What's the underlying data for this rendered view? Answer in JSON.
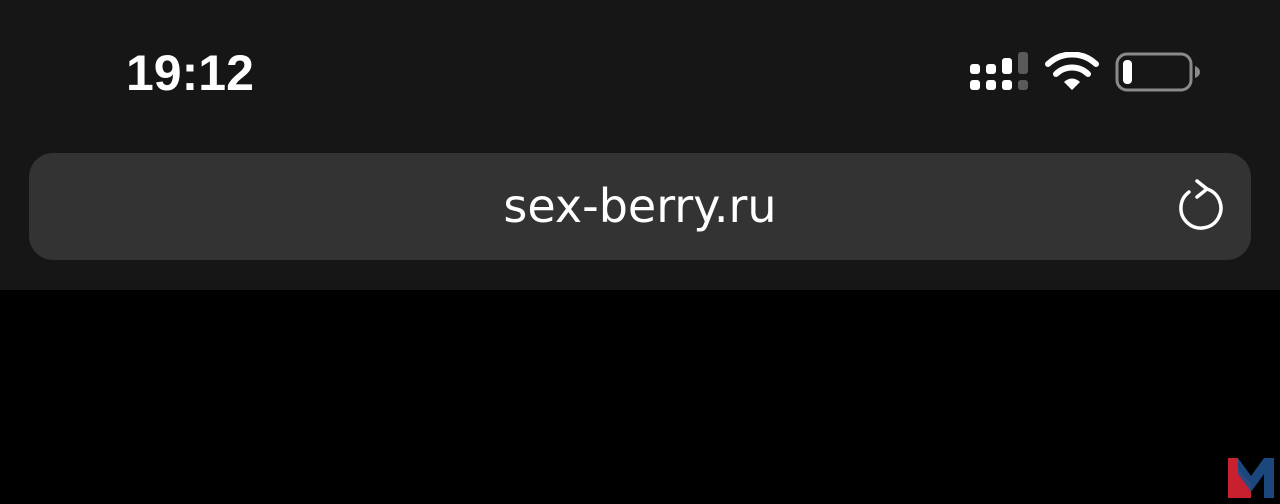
{
  "status_bar": {
    "time": "19:12",
    "icons": [
      "cellular-signal-icon",
      "wifi-icon",
      "battery-icon"
    ],
    "battery_level": 0.15
  },
  "address_bar": {
    "url": "sex-berry.ru",
    "reload_icon": "reload-icon"
  },
  "colors": {
    "chrome_background": "#161616",
    "address_bar_background": "#333333",
    "content_background": "#000000",
    "text": "#ffffff",
    "watermark_red": "#c8202f",
    "watermark_blue": "#1f4f8a"
  },
  "watermark": {
    "icon": "m-logo-icon"
  }
}
